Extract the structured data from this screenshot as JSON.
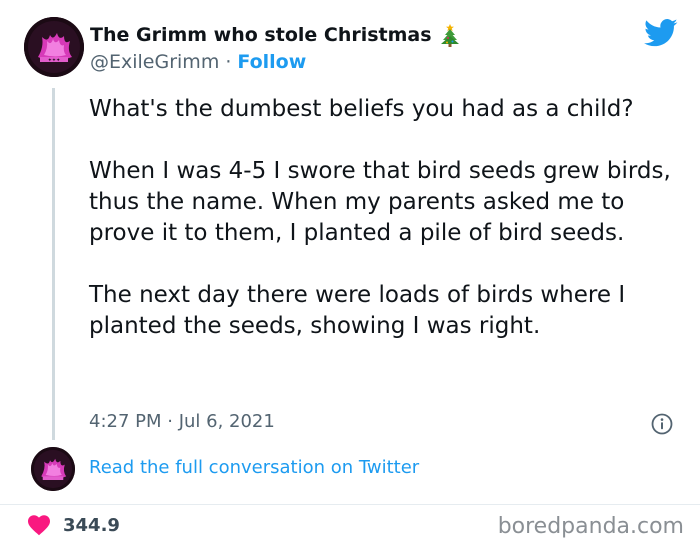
{
  "author": {
    "display_name": "The Grimm who stole Christmas",
    "name_emoji_icon": "christmas-tree-icon",
    "handle": "@ExileGrimm",
    "separator": "·",
    "follow_label": "Follow"
  },
  "tweet": {
    "paragraphs": [
      "What's the dumbest beliefs you had as a child?",
      "When I was 4-5 I swore that bird seeds grew birds, thus the name. When my parents asked me to prove it to them, I planted a pile of bird seeds.",
      "The next day there were loads of birds where I planted the seeds, showing I was right."
    ],
    "timestamp": "4:27 PM · Jul 6, 2021"
  },
  "footer": {
    "read_conversation_label": "Read the full conversation on Twitter",
    "like_count": "344.9",
    "watermark": "boredpanda.com"
  },
  "colors": {
    "accent": "#1d9bf0",
    "like": "#f91880",
    "text": "#0f1419",
    "muted": "#536471"
  }
}
